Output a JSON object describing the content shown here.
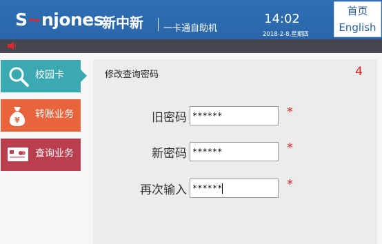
{
  "header": {
    "logo": "S‿njones",
    "brand_cn": "新中新",
    "subtitle": "一卡通自助机",
    "time": "14:02",
    "date": "2018-2-8,星期四",
    "home_label": "首页",
    "english_label": "English"
  },
  "sidebar": {
    "items": [
      {
        "label": "校园卡",
        "icon": "magnifier-icon",
        "color": "#3ba9b2",
        "active": true
      },
      {
        "label": "转账业务",
        "icon": "money-bag-icon",
        "color": "#e8643c",
        "active": false
      },
      {
        "label": "查询业务",
        "icon": "card-icon",
        "color": "#bb3e4f",
        "active": false
      }
    ]
  },
  "main": {
    "title": "修改查询密码",
    "countdown": "4",
    "fields": [
      {
        "label": "旧密码",
        "value": "******",
        "required": "*"
      },
      {
        "label": "新密码",
        "value": "******",
        "required": "*"
      },
      {
        "label": "再次输入",
        "value": "******",
        "required": "*"
      }
    ]
  },
  "colors": {
    "header_blue": "#2f6fb6",
    "notice_bar": "#47474f",
    "required_red": "#e02020"
  }
}
